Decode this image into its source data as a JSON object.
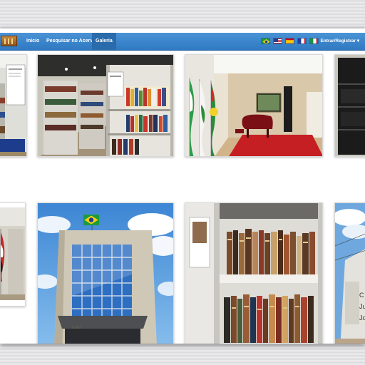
{
  "navbar": {
    "logo": "library-logo",
    "items": [
      {
        "label": "Início",
        "active": false
      },
      {
        "label": "Pesquisar no Acervo",
        "active": false
      },
      {
        "label": "Galeria",
        "active": true
      }
    ],
    "languages": [
      "Português (Brasil)",
      "English",
      "Español",
      "Français",
      "Italiano"
    ],
    "login_label": "Entrar/Registrar ▾"
  },
  "gallery": {
    "photos": [
      "library-shelves-corner",
      "library-shelves-aisle",
      "auditorium-flags-piano",
      "dark-bookcase",
      "hallway-flags",
      "building-facade-brazil-flag",
      "old-books-shelf",
      "building-corner-sky"
    ]
  },
  "colors": {
    "navbar": "#2f79c2",
    "navbar_active": "#2a6bac",
    "background": "#e4e4e6"
  }
}
